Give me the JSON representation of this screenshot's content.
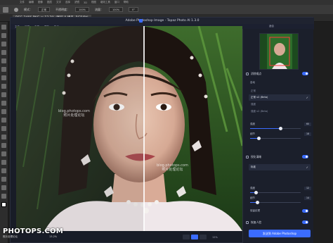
{
  "photoshop": {
    "menu_items": [
      "文件",
      "编辑",
      "图像",
      "图层",
      "文字",
      "选择",
      "滤镜",
      "3D",
      "视图",
      "增效工具",
      "窗口",
      "帮助"
    ],
    "options": {
      "mode_label": "模式：",
      "mode_value": "正常",
      "opacity_label": "不透明度：",
      "opacity_value": "100%",
      "flow_label": "流量：",
      "flow_value": "100%",
      "angle_value": "0°"
    },
    "document_tab": "DSC_2466.PNG @ 13.2% (图层 0 拷贝, RGB/8*)"
  },
  "topaz": {
    "window_title": "Adobe Photoshop Image - Topaz Photo AI 1.3.0",
    "menu_items": [
      "文件",
      "编辑",
      "查看",
      "帮助",
      "账户"
    ],
    "watermark_left": [
      "blog.photops.com",
      "照片处理论坛"
    ],
    "watermark_right": [
      "blog.photops.com",
      "照片处理论坛"
    ],
    "panel": {
      "fit_label": "适合",
      "section_denoise": {
        "title": "消除噪点",
        "enabled": true,
        "auto_label": "自动",
        "models": [
          {
            "label": "正常",
            "selected": false
          },
          {
            "label": "正常 v2 (Beta)",
            "selected": true
          },
          {
            "label": "强度",
            "selected": false
          },
          {
            "label": "强度 v2 (Beta)",
            "selected": false
          }
        ],
        "sliders": [
          {
            "label": "强度",
            "value": 60,
            "max": 100
          },
          {
            "label": "细节",
            "value": 18,
            "max": 100
          }
        ]
      },
      "section_sharpen": {
        "title": "锐化清晰",
        "enabled": true,
        "models": [
          {
            "label": "标准",
            "selected": true
          }
        ],
        "sliders": [
          {
            "label": "强度",
            "value": 12,
            "max": 100
          },
          {
            "label": "细节",
            "value": 14,
            "max": 100
          }
        ],
        "toggle_label": "保留纹理",
        "toggle_enabled": true
      },
      "section_face": {
        "title": "恢复人脸",
        "enabled": true
      },
      "send_button": "发送到 Adobe Photoshop"
    },
    "zoom_value": "12%"
  },
  "watermark": {
    "brand": "PHOTOPS.COM",
    "subtitle": "照片处理论坛",
    "status_zoom": "13.2%"
  },
  "colors": {
    "accent": "#3b6cff",
    "panel_bg": "#1b1f2b",
    "ps_bg": "#1e1e1e"
  }
}
